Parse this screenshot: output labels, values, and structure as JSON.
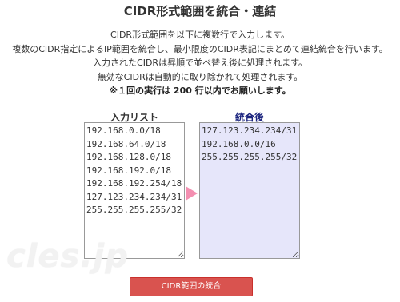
{
  "header": {
    "title": "CIDR形式範囲を統合・連結"
  },
  "description": {
    "line1": "CIDR形式範囲を以下に複数行で入力します。",
    "line2": "複数のCIDR指定によるIP範囲を統合し、最小限度のCIDR表記にまとめて連結統合を行います。",
    "line3": "入力されたCIDRは昇順で並べ替え後に処理されます。",
    "line4": "無効なCIDRは自動的に取り除かれて処理されます。",
    "note": "※１回の実行は 200 行以内でお願いします。"
  },
  "input_list": {
    "label": "入力リスト",
    "value": "192.168.0.0/18\n192.168.64.0/18\n192.168.128.0/18\n192.168.192.0/18\n192.168.192.254/18\n127.123.234.234/31\n255.255.255.255/32"
  },
  "output_list": {
    "label": "統合後",
    "value": "127.123.234.234/31\n192.168.0.0/16\n255.255.255.255/32"
  },
  "watermark": {
    "text": "cles.jp"
  },
  "actions": {
    "merge_button_label": "CIDR範囲の統合"
  },
  "colors": {
    "button_bg": "#d9534f",
    "output_bg": "#e6e6fa",
    "arrow": "#f48fb1",
    "output_label": "#1a237e"
  },
  "icons": {
    "arrow": "arrow-right-icon"
  }
}
